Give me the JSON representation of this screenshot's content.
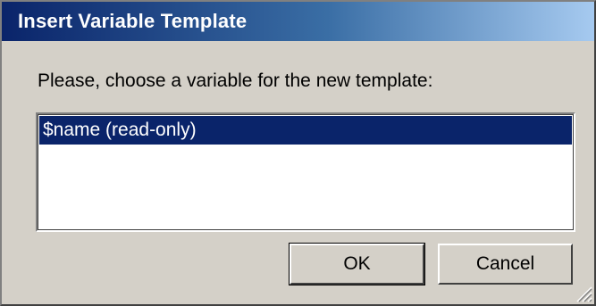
{
  "dialog": {
    "title": "Insert Variable Template",
    "prompt": "Please, choose a variable for the new template:",
    "variables": [
      {
        "label": "$name (read-only)",
        "selected": true
      }
    ],
    "ok_label": "OK",
    "cancel_label": "Cancel"
  },
  "colors": {
    "title_bar_start": "#0a246a",
    "title_bar_end": "#a6caf0",
    "dialog_bg": "#d4d0c8",
    "selection_bg": "#0a246a"
  },
  "icons": {
    "resize_grip": "resize-grip-icon"
  }
}
